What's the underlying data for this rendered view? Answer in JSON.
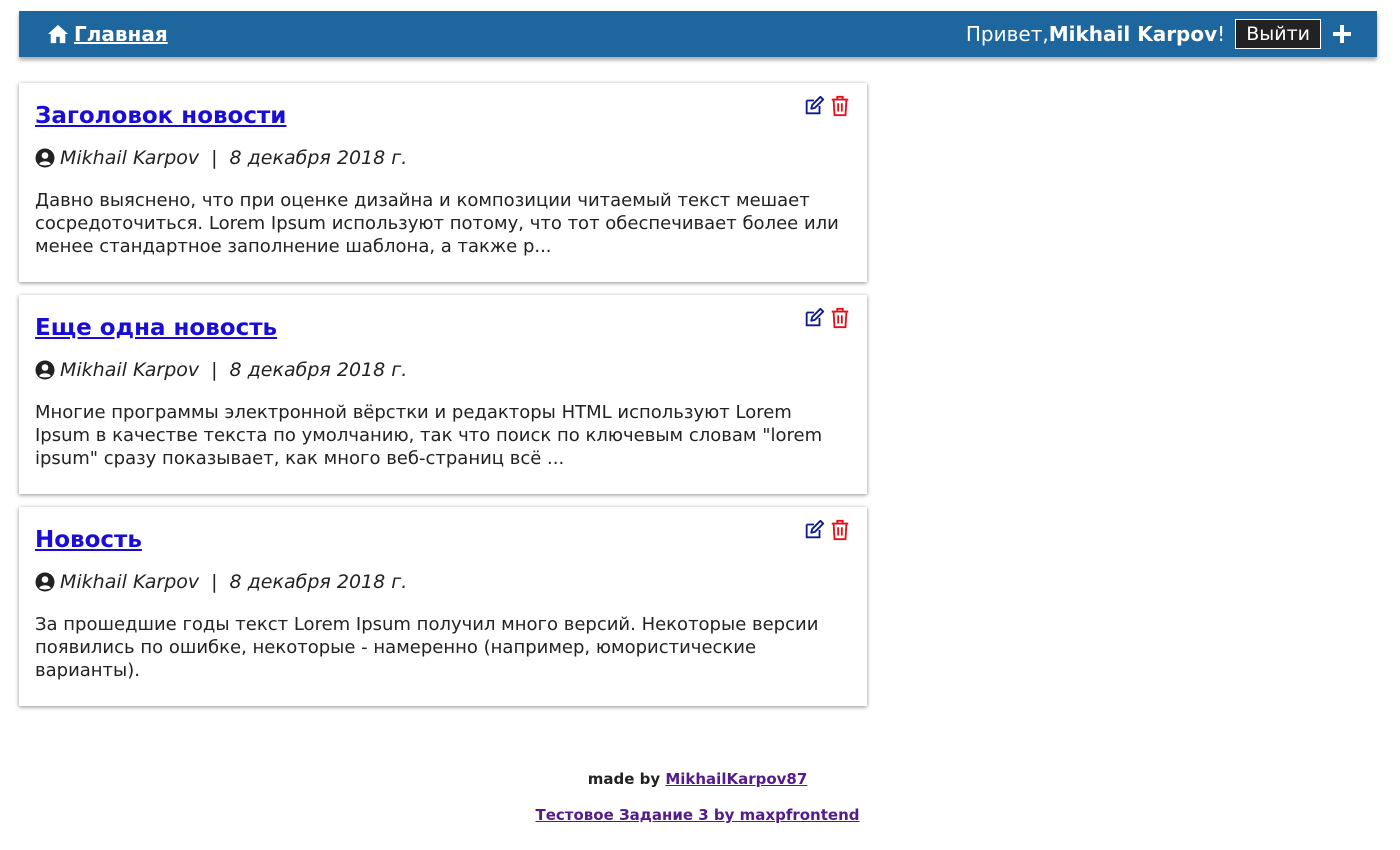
{
  "header": {
    "home_label": "Главная",
    "greeting_prefix": "Привет, ",
    "user_name": "Mikhail Karpov",
    "greeting_suffix": "!",
    "logout_label": "Выйти"
  },
  "colors": {
    "header_bg": "#1d679e",
    "edit_icon": "#0b1a8f",
    "delete_icon": "#e0111b",
    "title_link": "#1a0dd8"
  },
  "posts": [
    {
      "title": "Заголовок новости",
      "author": "Mikhail Karpov",
      "date": "8 декабря 2018 г.",
      "excerpt": "Давно выяснено, что при оценке дизайна и композиции читаемый текст мешает сосредоточиться. Lorem Ipsum используют потому, что тот обеспечивает более или менее стандартное заполнение шаблона, а также р..."
    },
    {
      "title": "Еще одна новость",
      "author": "Mikhail Karpov",
      "date": "8 декабря 2018 г.",
      "excerpt": "Многие программы электронной вёрстки и редакторы HTML используют Lorem Ipsum в качестве текста по умолчанию, так что поиск по ключевым словам \"lorem ipsum\" сразу показывает, как много веб-страниц всё ..."
    },
    {
      "title": "Новость",
      "author": "Mikhail Karpov",
      "date": "8 декабря 2018 г.",
      "excerpt": "За прошедшие годы текст Lorem Ipsum получил много версий. Некоторые версии появились по ошибке, некоторые - намеренно (например, юмористические варианты)."
    }
  ],
  "footer": {
    "made_by": "made by ",
    "author_link": "MikhailKarpov87",
    "project_link": "Тестовое Задание 3 by maxpfrontend"
  }
}
